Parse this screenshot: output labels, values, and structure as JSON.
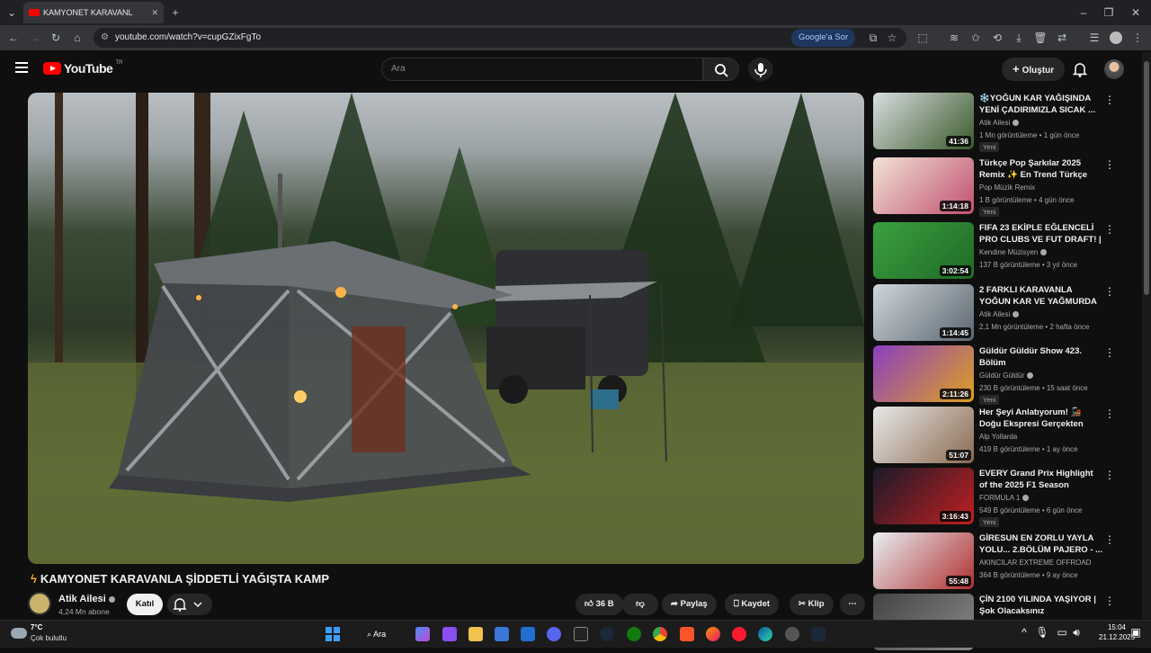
{
  "browser": {
    "tab_title": "KAMYONET KARAVANL",
    "url": "youtube.com/watch?v=cupGZixFgTo",
    "google_ask": "Google'a Sor"
  },
  "header": {
    "logo": "YouTube",
    "logo_tr": "TR",
    "search_placeholder": "Ara",
    "create_label": "Oluştur"
  },
  "video": {
    "title": "KAMYONET KARAVANLA ŞİDDETLİ YAĞIŞTA KAMP",
    "channel": "Atik Ailesi",
    "subscribers": "4,24 Mn abone",
    "join_label": "Katıl",
    "likes": "36 B",
    "share_label": "Paylaş",
    "save_label": "Kaydet",
    "clip_label": "Klip"
  },
  "recommendations": [
    {
      "title": "❄️YOĞUN KAR YAĞIŞINDA YENİ ÇADIRIMIZLA SICAK ...",
      "channel": "Atik Ailesi",
      "verified": true,
      "meta": "1 Mn görüntüleme • 1 gün önce",
      "badge": "Yeni",
      "duration": "41:36",
      "c1": "#d8dde0",
      "c2": "#3a5a2a"
    },
    {
      "title": "Türkçe Pop Şarkılar 2025 Remix ✨ En Trend Türkçe Şarkılar ...",
      "channel": "Pop Müzik Remix",
      "verified": false,
      "meta": "1 B görüntüleme • 4 gün önce",
      "badge": "Yeni",
      "duration": "1:14:18",
      "c1": "#f2e3d5",
      "c2": "#c05070"
    },
    {
      "title": "FIFA 23 EKİPLE EĞLENCELİ PRO CLUBS VE FUT DRAFT! | ...",
      "channel": "Kendine Müzisyen",
      "verified": true,
      "meta": "137 B görüntüleme • 3 yıl önce",
      "badge": "",
      "duration": "3:02:54",
      "c1": "#3aa040",
      "c2": "#1f6a25"
    },
    {
      "title": "2 FARKLI KARAVANLA YOĞUN KAR VE YAĞMURDA KAMP",
      "channel": "Atik Ailesi",
      "verified": true,
      "meta": "2,1 Mn görüntüleme • 2 hafta önce",
      "badge": "",
      "duration": "1:14:45",
      "c1": "#cfd6da",
      "c2": "#5a6670"
    },
    {
      "title": "Güldür Güldür Show 423. Bölüm",
      "channel": "Güldür Güldür",
      "verified": true,
      "meta": "230 B görüntüleme • 15 saat önce",
      "badge": "Yeni",
      "duration": "2:11:26",
      "c1": "#8a3fc0",
      "c2": "#e0a020"
    },
    {
      "title": "Her Şeyi Anlatıyorum! 🚂 Doğu Ekspresi Gerçekten Değer mi? ...",
      "channel": "Alp Yollarda",
      "verified": false,
      "meta": "419 B görüntüleme • 1 ay önce",
      "badge": "",
      "duration": "51:07",
      "c1": "#e8e8e8",
      "c2": "#8a6a50"
    },
    {
      "title": "EVERY Grand Prix Highlight of the 2025 F1 Season",
      "channel": "FORMULA 1",
      "verified": true,
      "meta": "549 B görüntüleme • 6 gün önce",
      "badge": "Yeni",
      "duration": "3:16:43",
      "c1": "#1a1a2a",
      "c2": "#c02020"
    },
    {
      "title": "GİRESUN EN ZORLU YAYLA YOLU... 2.BÖLÜM PAJERO - ...",
      "channel": "AKINCILAR EXTREME OFFROAD",
      "verified": false,
      "meta": "364 B görüntüleme • 9 ay önce",
      "badge": "",
      "duration": "55:48",
      "c1": "#e8eef2",
      "c2": "#b03030"
    },
    {
      "title": "ÇİN 2100 YILINDA YAŞIYOR | Şok Olacaksınız",
      "channel": "",
      "verified": false,
      "meta": "",
      "badge": "",
      "duration": "",
      "c1": "#444",
      "c2": "#888"
    }
  ],
  "taskbar": {
    "temperature": "7°C",
    "weather": "Çok bulutlu",
    "search_label": "Ara",
    "time": "15:04",
    "date": "21.12.2025"
  }
}
